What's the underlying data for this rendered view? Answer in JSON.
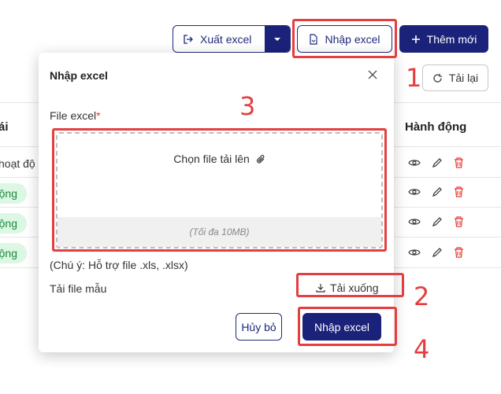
{
  "toolbar": {
    "export_label": "Xuất excel",
    "import_label": "Nhập excel",
    "add_label": "Thêm mới",
    "reload_label": "Tải lại"
  },
  "table": {
    "status_header": "ái",
    "actions_header": "Hành động",
    "first_status": "hoạt độ",
    "statuses": [
      "ộng",
      "ộng",
      "ộng"
    ]
  },
  "modal": {
    "title": "Nhập excel",
    "file_label": "File excel",
    "required_mark": "*",
    "dropzone_text": "Chọn file tải lên",
    "dropzone_hint": "(Tối đa 10MB)",
    "note": "(Chú ý: Hỗ trợ file .xls, .xlsx)",
    "template_label": "Tải file mẫu",
    "download_label": "Tải xuống",
    "cancel_label": "Hủy bỏ",
    "submit_label": "Nhập excel"
  },
  "annotations": [
    "1",
    "2",
    "3",
    "4"
  ],
  "colors": {
    "primary": "#1b2279",
    "annotation": "#e53e3e",
    "success": "#1c8a3c"
  }
}
